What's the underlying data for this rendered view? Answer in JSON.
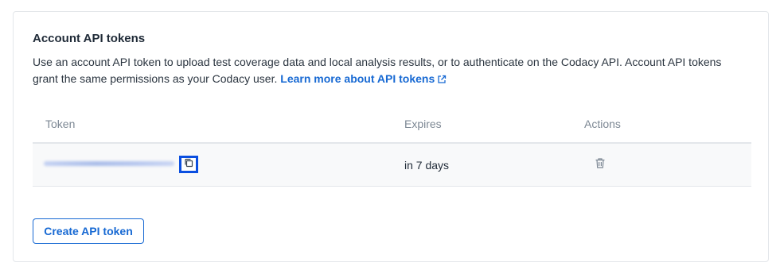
{
  "section": {
    "title": "Account API tokens",
    "description": "Use an account API token to upload test coverage data and local analysis results, or to authenticate on the Codacy API. Account API tokens grant the same permissions as your Codacy user.",
    "learn_more_label": "Learn more about API tokens"
  },
  "table": {
    "headers": {
      "token": "Token",
      "expires": "Expires",
      "actions": "Actions"
    },
    "rows": [
      {
        "token_masked": true,
        "expires": "in 7 days"
      }
    ]
  },
  "buttons": {
    "create_label": "Create API token"
  },
  "icons": {
    "external": "external-link-icon",
    "copy": "copy-icon",
    "delete": "trash-icon"
  },
  "colors": {
    "link": "#1769d3",
    "focus_outline": "#0b4fe0",
    "border": "#e3e6ea",
    "row_bg": "#f8f9fa",
    "header_text": "#7d8894"
  }
}
